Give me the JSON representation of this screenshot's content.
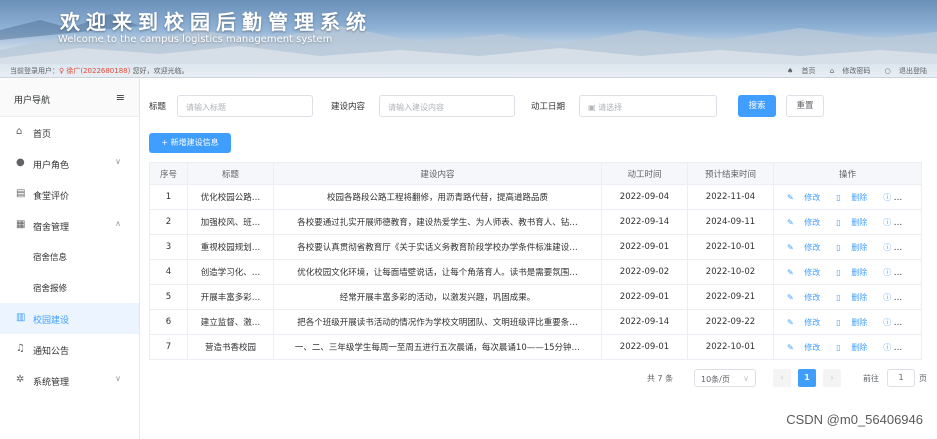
{
  "banner": {
    "title": "欢迎来到校园后勤管理系统",
    "subtitle": "Welcome to the campus logistics management system"
  },
  "infobar": {
    "prefix": "当前登录用户：",
    "user": "徐广(2022680188)",
    "greeting": "您好，欢迎光临。",
    "links": [
      "首页",
      "修改密码",
      "退出登陆"
    ]
  },
  "sidebar": {
    "header": "用户导航",
    "items": [
      {
        "label": "首页"
      },
      {
        "label": "用户角色"
      },
      {
        "label": "食堂评价"
      },
      {
        "label": "宿舍管理"
      },
      {
        "label": "宿舍信息"
      },
      {
        "label": "宿舍报修"
      },
      {
        "label": "校园建设"
      },
      {
        "label": "通知公告"
      },
      {
        "label": "系统管理"
      }
    ]
  },
  "search": {
    "title_label": "标题",
    "title_placeholder": "请输入标题",
    "content_label": "建设内容",
    "content_placeholder": "请输入建设内容",
    "date_label": "动工日期",
    "date_placeholder": "请选择",
    "search_btn": "搜索",
    "reset_btn": "重置"
  },
  "add_btn": "+ 新增建设信息",
  "table": {
    "headers": [
      "序号",
      "标题",
      "建设内容",
      "动工时间",
      "预计结束时间",
      "操作"
    ],
    "ops": [
      "修改",
      "删除",
      "详情"
    ],
    "rows": [
      [
        "1",
        "优化校园公路…",
        "校园各路段公路工程将翻修，用沥青路代替，提高道路品质",
        "2022-09-04",
        "2022-11-04"
      ],
      [
        "2",
        "加强校风、班…",
        "各校要通过扎实开展师德教育，建设热爱学生、为人师表、教书育人、钻…",
        "2022-09-14",
        "2024-09-11"
      ],
      [
        "3",
        "重视校园规划…",
        "各校要认真贯彻省教育厅《关于实话义务教育阶段学校办学条件标准建设…",
        "2022-09-01",
        "2022-10-01"
      ],
      [
        "4",
        "创造学习化、…",
        "优化校园文化环境，让每面墙壁说话，让每个角落育人。读书是需要氛围…",
        "2022-09-02",
        "2022-10-02"
      ],
      [
        "5",
        "开展丰富多彩…",
        "经常开展丰富多彩的活动，以激发兴趣，巩固成果。",
        "2022-09-01",
        "2022-09-21"
      ],
      [
        "6",
        "建立监督、激…",
        "把各个班级开展读书活动的情况作为学校文明团队、文明班级评比重要条…",
        "2022-09-14",
        "2022-09-22"
      ],
      [
        "7",
        "营造书香校园",
        "一、二、三年级学生每周一至周五进行五次晨诵，每次晨诵10——15分钟…",
        "2022-09-01",
        "2022-10-01"
      ]
    ]
  },
  "pager": {
    "total": "共 7 条",
    "size": "10条/页",
    "current": "1",
    "goto": "前往",
    "page": "1",
    "unit": "页"
  },
  "watermark": "CSDN @m0_56406946"
}
